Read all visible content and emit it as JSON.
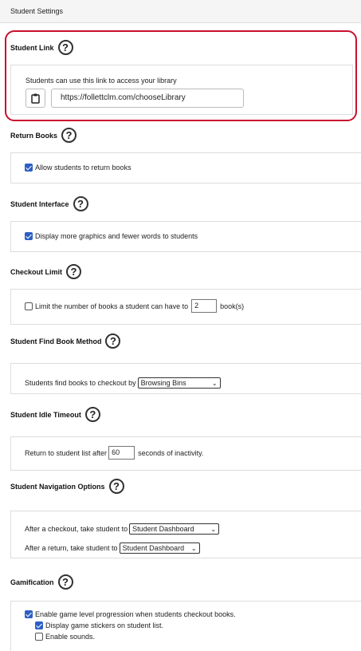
{
  "header": {
    "title": "Student Settings"
  },
  "help_icon_glyph": "?",
  "student_link": {
    "title": "Student Link",
    "description": "Students can use this link to access your library",
    "url": "https://follettclm.com/chooseLibrary",
    "copy_icon": "clipboard-icon",
    "highlight_color": "#c8102e"
  },
  "return_books": {
    "title": "Return Books",
    "option": {
      "label": "Allow students to return books",
      "checked": true
    }
  },
  "student_interface": {
    "title": "Student Interface",
    "option": {
      "label": "Display more graphics and fewer words to students",
      "checked": true
    }
  },
  "checkout_limit": {
    "title": "Checkout Limit",
    "label_before": "Limit the number of books a student can have to",
    "value": "2",
    "label_after": "book(s)",
    "checked": false
  },
  "find_book_method": {
    "title": "Student Find Book Method",
    "label": "Students find books to checkout by",
    "selected": "Browsing Bins"
  },
  "idle_timeout": {
    "title": "Student Idle Timeout",
    "label_before": "Return to student list after",
    "value": "60",
    "label_after": "seconds of inactivity."
  },
  "navigation_options": {
    "title": "Student Navigation Options",
    "after_checkout_label": "After a checkout, take student to",
    "after_checkout_selected": "Student Dashboard",
    "after_return_label": "After a return, take student to",
    "after_return_selected": "Student Dashboard"
  },
  "gamification": {
    "title": "Gamification",
    "options": [
      {
        "label": "Enable game level progression when students checkout books.",
        "checked": true
      },
      {
        "label": "Display game stickers on student list.",
        "checked": true
      },
      {
        "label": "Enable sounds.",
        "checked": false
      }
    ]
  },
  "accent_color": "#2d5fc4"
}
